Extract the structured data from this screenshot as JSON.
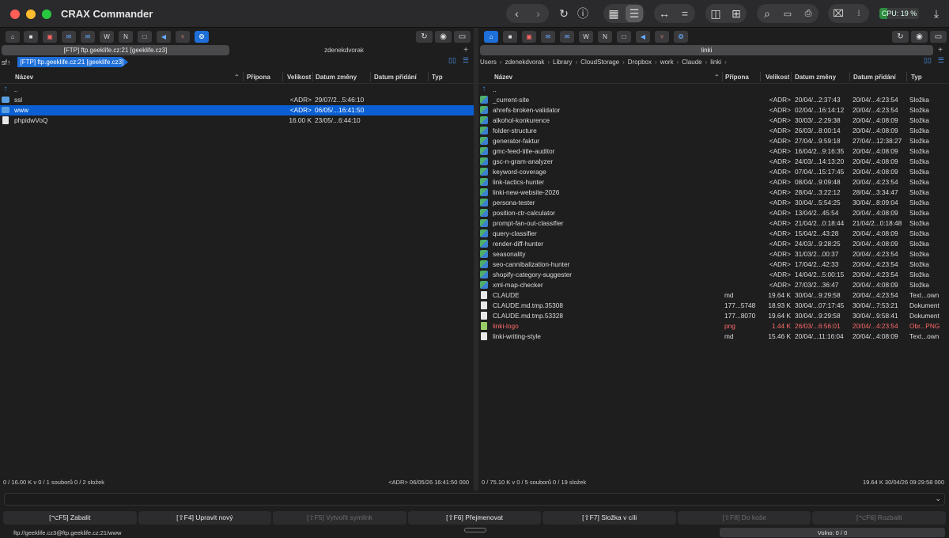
{
  "app": {
    "title": "CRAX Commander"
  },
  "toolbar": {
    "cpu_label": "CPU: 19 %",
    "cpu_load": 0.19,
    "icons": [
      "chevron-left-icon",
      "chevron-right-icon",
      "refresh-icon",
      "info-icon",
      "grid-view-icon",
      "list-view-icon",
      "swap-arrows-icon",
      "equals-icon",
      "sidebar-icon",
      "dual-pane-icon",
      "search-icon",
      "terminal-icon",
      "print-icon",
      "trash-icon",
      "archive-icon",
      "download-icon"
    ]
  },
  "left": {
    "tabs": [
      {
        "label": "[FTP] ftp.geeklife.cz:21 [geeklife.cz3]"
      },
      {
        "label": "zdenekdvorak"
      }
    ],
    "path_prefix": "sf↑",
    "path_chip": "[FTP] ftp.geeklife.cz:21 [geeklife.cz3]",
    "columns": {
      "name": "Název",
      "ext": "Přípona",
      "size": "Velikost",
      "modified": "Datum změny",
      "added": "Datum přidání",
      "type": "Typ"
    },
    "rows": [
      {
        "icon": "up",
        "name": "..",
        "ext": "",
        "size": "",
        "modified": "",
        "added": "",
        "type": ""
      },
      {
        "icon": "folder",
        "name": "ssl",
        "ext": "",
        "size": "<ADR>",
        "modified": "29/07/2...5:46:10",
        "added": "",
        "type": ""
      },
      {
        "icon": "folder",
        "name": "www",
        "ext": "",
        "size": "<ADR>",
        "modified": "06/05/...16:41:50",
        "added": "",
        "type": ""
      },
      {
        "icon": "file",
        "name": "phpidwVoQ",
        "ext": "",
        "size": "16.00 K",
        "modified": "23/05/...6:44:10",
        "added": "",
        "type": ""
      }
    ],
    "status_left": "0 / 16.00 K v 0 / 1 souborů 0 / 2 složek",
    "status_right": "<ADR> 06/05/26 16:41:50 000"
  },
  "right": {
    "tabs": [
      {
        "label": "linki"
      }
    ],
    "breadcrumb": [
      "Users",
      "zdenekdvorak",
      "Library",
      "CloudStorage",
      "Dropbox",
      "work",
      "Claude",
      "linki"
    ],
    "columns": {
      "name": "Název",
      "ext": "Přípona",
      "size": "Velikost",
      "modified": "Datum změny",
      "added": "Datum přidání",
      "type": "Typ"
    },
    "rows": [
      {
        "icon": "up",
        "name": "..",
        "ext": "",
        "size": "",
        "modified": "",
        "added": "",
        "type": ""
      },
      {
        "icon": "cfolder",
        "name": "_current-site",
        "ext": "",
        "size": "<ADR>",
        "modified": "20/04/...2:37:43",
        "added": "20/04/...4:23:54",
        "type": "Složka"
      },
      {
        "icon": "cfolder",
        "name": "ahrefs-broken-validator",
        "ext": "",
        "size": "<ADR>",
        "modified": "02/04/...16:14:12",
        "added": "20/04/...4:23:54",
        "type": "Složka"
      },
      {
        "icon": "cfolder",
        "name": "alkohol-konkurence",
        "ext": "",
        "size": "<ADR>",
        "modified": "30/03/...2:29:38",
        "added": "20/04/...4:08:09",
        "type": "Složka"
      },
      {
        "icon": "cfolder",
        "name": "folder-structure",
        "ext": "",
        "size": "<ADR>",
        "modified": "26/03/...8:00:14",
        "added": "20/04/...4:08:09",
        "type": "Složka"
      },
      {
        "icon": "cfolder",
        "name": "generator-faktur",
        "ext": "",
        "size": "<ADR>",
        "modified": "27/04/...9:59:18",
        "added": "27/04/...12:38:27",
        "type": "Složka"
      },
      {
        "icon": "cfolder",
        "name": "gmc-feed-title-auditor",
        "ext": "",
        "size": "<ADR>",
        "modified": "16/04/2...9:16:35",
        "added": "20/04/...4:08:09",
        "type": "Složka"
      },
      {
        "icon": "cfolder",
        "name": "gsc-n-gram-analyzer",
        "ext": "",
        "size": "<ADR>",
        "modified": "24/03/...14:13:20",
        "added": "20/04/...4:08:09",
        "type": "Složka"
      },
      {
        "icon": "cfolder",
        "name": "keyword-coverage",
        "ext": "",
        "size": "<ADR>",
        "modified": "07/04/...15:17:45",
        "added": "20/04/...4:08:09",
        "type": "Složka"
      },
      {
        "icon": "cfolder",
        "name": "link-tactics-hunter",
        "ext": "",
        "size": "<ADR>",
        "modified": "08/04/...9:09:48",
        "added": "20/04/...4:23:54",
        "type": "Složka"
      },
      {
        "icon": "cfolder",
        "name": "linki-new-website-2026",
        "ext": "",
        "size": "<ADR>",
        "modified": "28/04/...3:22:12",
        "added": "28/04/...3:34:47",
        "type": "Složka"
      },
      {
        "icon": "cfolder",
        "name": "persona-tester",
        "ext": "",
        "size": "<ADR>",
        "modified": "30/04/...5:54:25",
        "added": "30/04/...8:09:04",
        "type": "Složka"
      },
      {
        "icon": "cfolder",
        "name": "position-ctr-calculator",
        "ext": "",
        "size": "<ADR>",
        "modified": "13/04/2...45:54",
        "added": "20/04/...4:08:09",
        "type": "Složka"
      },
      {
        "icon": "cfolder",
        "name": "prompt-fan-out-classifier",
        "ext": "",
        "size": "<ADR>",
        "modified": "21/04/2...0:18:44",
        "added": "21/04/2...0:18:48",
        "type": "Složka"
      },
      {
        "icon": "cfolder",
        "name": "query-classifier",
        "ext": "",
        "size": "<ADR>",
        "modified": "15/04/2...43:28",
        "added": "20/04/...4:08:09",
        "type": "Složka"
      },
      {
        "icon": "cfolder",
        "name": "render-diff-hunter",
        "ext": "",
        "size": "<ADR>",
        "modified": "24/03/...9:28:25",
        "added": "20/04/...4:08:09",
        "type": "Složka"
      },
      {
        "icon": "cfolder",
        "name": "seasonality",
        "ext": "",
        "size": "<ADR>",
        "modified": "31/03/2...00:37",
        "added": "20/04/...4:23:54",
        "type": "Složka"
      },
      {
        "icon": "cfolder",
        "name": "seo-cannibalization-hunter",
        "ext": "",
        "size": "<ADR>",
        "modified": "17/04/2...42:33",
        "added": "20/04/...4:23:54",
        "type": "Složka"
      },
      {
        "icon": "cfolder",
        "name": "shopify-category-suggester",
        "ext": "",
        "size": "<ADR>",
        "modified": "14/04/2...5:00:15",
        "added": "20/04/...4:23:54",
        "type": "Složka"
      },
      {
        "icon": "cfolder",
        "name": "xml-map-checker",
        "ext": "",
        "size": "<ADR>",
        "modified": "27/03/2...36:47",
        "added": "20/04/...4:08:09",
        "type": "Složka"
      },
      {
        "icon": "doc",
        "name": "CLAUDE",
        "ext": "md",
        "size": "19.64 K",
        "modified": "30/04/...9:29:58",
        "added": "20/04/...4:23:54",
        "type": "Text...own"
      },
      {
        "icon": "doc",
        "name": "CLAUDE.md.tmp.35308",
        "ext": "177...5748",
        "size": "18.93 K",
        "modified": "30/04/...07:17:45",
        "added": "30/04/...7:53:21",
        "type": "Dokument"
      },
      {
        "icon": "doc",
        "name": "CLAUDE.md.tmp.53328",
        "ext": "177...8070",
        "size": "19.64 K",
        "modified": "30/04/...9:29:58",
        "added": "30/04/...9:58:41",
        "type": "Dokument"
      },
      {
        "icon": "img",
        "name": "linki-logo",
        "ext": "png",
        "size": "1.44 K",
        "modified": "26/03/...6:56:01",
        "added": "20/04/...4:23:54",
        "type": "Obr...PNG",
        "highlight": true
      },
      {
        "icon": "doc",
        "name": "linki-writing-style",
        "ext": "md",
        "size": "15.46 K",
        "modified": "20/04/...11:16:04",
        "added": "20/04/...4:08:09",
        "type": "Text...own"
      }
    ],
    "status_left": "0 / 75.10 K v 0 / 5 souborů 0 / 19 složek",
    "status_right": "19.64 K 30/04/26 09:29:58 000"
  },
  "fkeys": [
    {
      "label": "[⌥F5] Zabalit",
      "enabled": true
    },
    {
      "label": "[⇧F4] Upravit nový",
      "enabled": true
    },
    {
      "label": "[⇧F5] Vytvořit symlink",
      "enabled": false
    },
    {
      "label": "[⇧F6] Přejmenovat",
      "enabled": true
    },
    {
      "label": "[⇧F7] Složka v cíli",
      "enabled": true
    },
    {
      "label": "[⇧F8] Do koše",
      "enabled": false
    },
    {
      "label": "[⌥F6] Rozbalit",
      "enabled": false
    }
  ],
  "bottom": {
    "url": "ftp://geeklife.cz3@ftp.geeklife.cz:21/www",
    "free": "Volno: 0 / 0"
  }
}
